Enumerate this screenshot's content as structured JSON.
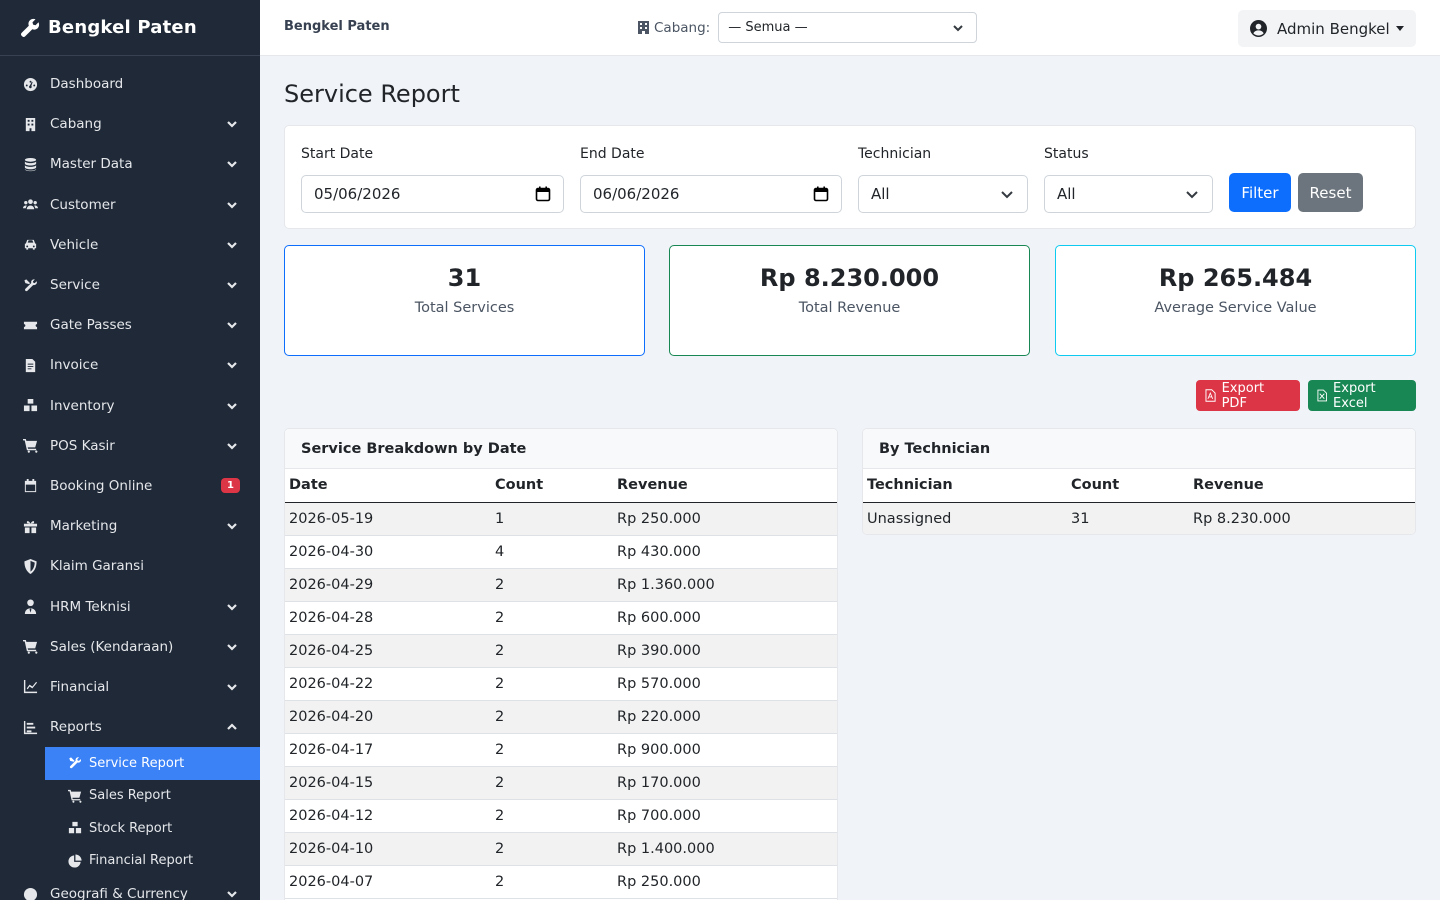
{
  "app": {
    "brand": "Bengkel Paten"
  },
  "sidebar": {
    "items": [
      {
        "label": "Dashboard",
        "icon": "gauge-icon",
        "chevron": false
      },
      {
        "label": "Cabang",
        "icon": "building-icon",
        "chevron": true
      },
      {
        "label": "Master Data",
        "icon": "database-icon",
        "chevron": true
      },
      {
        "label": "Customer",
        "icon": "users-icon",
        "chevron": true
      },
      {
        "label": "Vehicle",
        "icon": "car-icon",
        "chevron": true
      },
      {
        "label": "Service",
        "icon": "tools-icon",
        "chevron": true
      },
      {
        "label": "Gate Passes",
        "icon": "ticket-icon",
        "chevron": true
      },
      {
        "label": "Invoice",
        "icon": "invoice-icon",
        "chevron": true
      },
      {
        "label": "Inventory",
        "icon": "boxes-icon",
        "chevron": true
      },
      {
        "label": "POS Kasir",
        "icon": "cart-icon",
        "chevron": true
      },
      {
        "label": "Booking Online",
        "icon": "calendar-icon",
        "badge": "1"
      },
      {
        "label": "Marketing",
        "icon": "gift-icon",
        "chevron": true
      },
      {
        "label": "Klaim Garansi",
        "icon": "shield-icon",
        "chevron": false
      },
      {
        "label": "HRM Teknisi",
        "icon": "user-tie-icon",
        "chevron": true
      },
      {
        "label": "Sales (Kendaraan)",
        "icon": "cart-icon",
        "chevron": true
      },
      {
        "label": "Financial",
        "icon": "chart-line-icon",
        "chevron": true
      },
      {
        "label": "Reports",
        "icon": "chart-bar-icon",
        "chevron": "up"
      }
    ],
    "reports_sub": [
      {
        "label": "Service Report",
        "icon": "tools-icon",
        "active": true
      },
      {
        "label": "Sales Report",
        "icon": "cart-icon",
        "active": false
      },
      {
        "label": "Stock Report",
        "icon": "boxes-icon",
        "active": false
      },
      {
        "label": "Financial Report",
        "icon": "pie-chart-icon",
        "active": false
      }
    ],
    "after": {
      "label": "Geografi & Currency",
      "icon": "globe-icon"
    }
  },
  "topbar": {
    "title": "Bengkel Paten",
    "branch_label": "Cabang:",
    "branch_value": "— Semua —",
    "user_name": "Admin Bengkel"
  },
  "page": {
    "title": "Service Report"
  },
  "filters": {
    "start_label": "Start Date",
    "start_value": "05/06/2026",
    "end_label": "End Date",
    "end_value": "06/06/2026",
    "tech_label": "Technician",
    "tech_value": "All",
    "status_label": "Status",
    "status_value": "All",
    "filter_btn": "Filter",
    "reset_btn": "Reset"
  },
  "stats": [
    {
      "value": "31",
      "label": "Total Services",
      "color": "#0d6efd"
    },
    {
      "value": "Rp 8.230.000",
      "label": "Total Revenue",
      "color": "#198754"
    },
    {
      "value": "Rp 265.484",
      "label": "Average Service Value",
      "color": "#0dcaf0"
    }
  ],
  "exports": {
    "pdf": "Export PDF",
    "excel": "Export Excel",
    "pdf_color": "#dc3545",
    "excel_color": "#198754"
  },
  "by_date": {
    "title": "Service Breakdown by Date",
    "headers": [
      "Date",
      "Count",
      "Revenue"
    ],
    "rows": [
      [
        "2026-05-19",
        "1",
        "Rp 250.000"
      ],
      [
        "2026-04-30",
        "4",
        "Rp 430.000"
      ],
      [
        "2026-04-29",
        "2",
        "Rp 1.360.000"
      ],
      [
        "2026-04-28",
        "2",
        "Rp 600.000"
      ],
      [
        "2026-04-25",
        "2",
        "Rp 390.000"
      ],
      [
        "2026-04-22",
        "2",
        "Rp 570.000"
      ],
      [
        "2026-04-20",
        "2",
        "Rp 220.000"
      ],
      [
        "2026-04-17",
        "2",
        "Rp 900.000"
      ],
      [
        "2026-04-15",
        "2",
        "Rp 170.000"
      ],
      [
        "2026-04-12",
        "2",
        "Rp 700.000"
      ],
      [
        "2026-04-10",
        "2",
        "Rp 1.400.000"
      ],
      [
        "2026-04-07",
        "2",
        "Rp 250.000"
      ]
    ]
  },
  "by_tech": {
    "title": "By Technician",
    "headers": [
      "Technician",
      "Count",
      "Revenue"
    ],
    "rows": [
      [
        "Unassigned",
        "31",
        "Rp 8.230.000"
      ]
    ]
  }
}
